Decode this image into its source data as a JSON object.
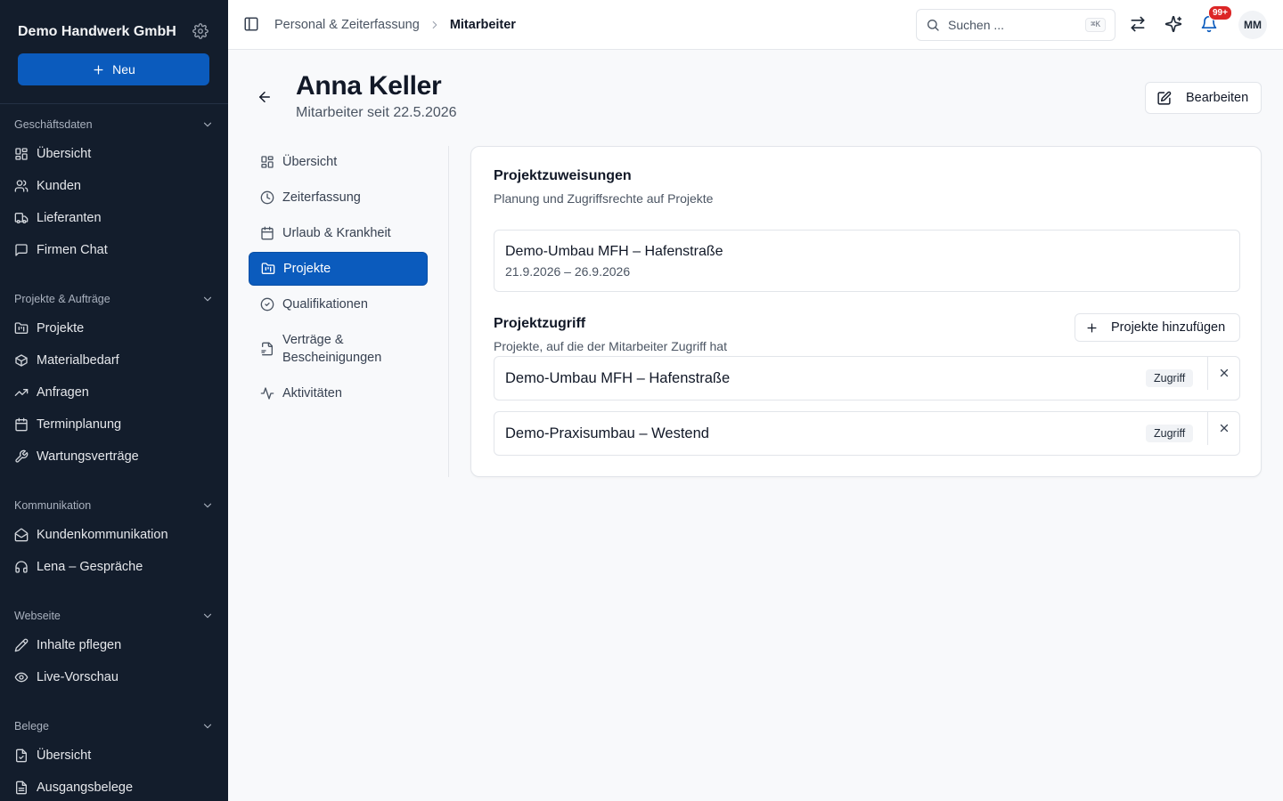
{
  "sidebar": {
    "company": "Demo Handwerk GmbH",
    "new_label": "Neu",
    "sections": [
      {
        "title": "Geschäftsdaten",
        "items": [
          "Übersicht",
          "Kunden",
          "Lieferanten",
          "Firmen Chat"
        ]
      },
      {
        "title": "Projekte & Aufträge",
        "items": [
          "Projekte",
          "Materialbedarf",
          "Anfragen",
          "Terminplanung",
          "Wartungsverträge"
        ]
      },
      {
        "title": "Kommunikation",
        "items": [
          "Kundenkommunikation",
          "Lena – Gespräche"
        ]
      },
      {
        "title": "Webseite",
        "items": [
          "Inhalte pflegen",
          "Live-Vorschau"
        ]
      },
      {
        "title": "Belege",
        "items": [
          "Übersicht",
          "Ausgangsbelege"
        ]
      }
    ]
  },
  "header": {
    "breadcrumb_parent": "Personal & Zeiterfassung",
    "breadcrumb_current": "Mitarbeiter",
    "search_placeholder": "Suchen ...",
    "search_shortcut": "⌘K",
    "notifications_badge": "99+",
    "avatar_initials": "MM"
  },
  "page": {
    "title": "Anna Keller",
    "subtitle": "Mitarbeiter seit 22.5.2026",
    "edit_label": "Bearbeiten"
  },
  "subnav": {
    "items": [
      "Übersicht",
      "Zeiterfassung",
      "Urlaub & Krankheit",
      "Projekte",
      "Qualifikationen",
      "Verträge & Bescheinigungen",
      "Aktivitäten"
    ],
    "active": "Projekte"
  },
  "card": {
    "assign_title": "Projektzuweisungen",
    "assign_desc": "Planung und Zugriffsrechte auf Projekte",
    "assignments": [
      {
        "name": "Demo-Umbau MFH – Hafenstraße",
        "dates": "21.9.2026 – 26.9.2026"
      }
    ],
    "access_title": "Projektzugriff",
    "access_desc": "Projekte, auf die der Mitarbeiter Zugriff hat",
    "add_label": "Projekte hinzufügen",
    "access": [
      {
        "name": "Demo-Umbau MFH – Hafenstraße",
        "badge": "Zugriff"
      },
      {
        "name": "Demo-Praxisumbau – Westend",
        "badge": "Zugriff"
      }
    ]
  },
  "icons": {
    "primary": "#0b5bbd",
    "sidebar_bg": "#131d2c",
    "badge": "#dc2626"
  }
}
